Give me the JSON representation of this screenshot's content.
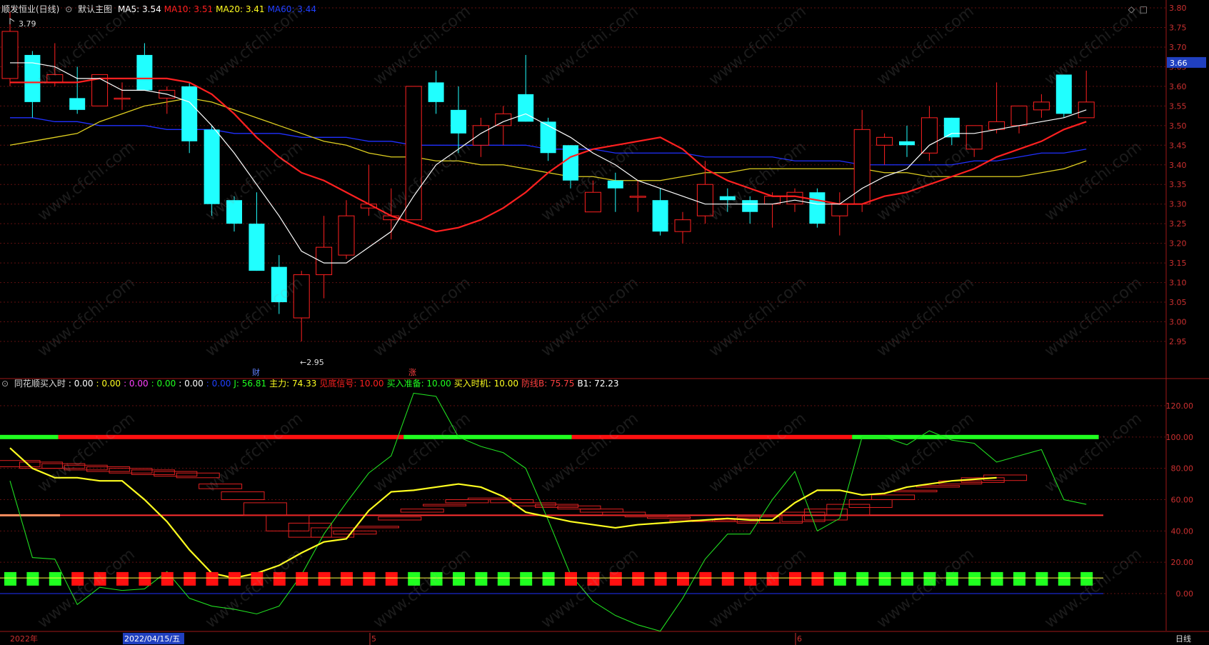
{
  "header": {
    "stock": "顺发恒业(日线)",
    "main_chart_label": "默认主图",
    "ma": [
      {
        "label": "MA5: 3.54",
        "color": "#ffffff"
      },
      {
        "label": "MA10: 3.51",
        "color": "#ff2020"
      },
      {
        "label": "MA20: 3.41",
        "color": "#ffff20"
      },
      {
        "label": "MA60: 3.44",
        "color": "#2040ff"
      }
    ]
  },
  "indicator_header": {
    "name": "同花顺买入时",
    "values": [
      {
        "label": ": 0.00",
        "color": "#ffffff"
      },
      {
        "label": ": 0.00",
        "color": "#ffff20"
      },
      {
        "label": ": 0.00",
        "color": "#ff40ff"
      },
      {
        "label": ": 0.00",
        "color": "#20ff20"
      },
      {
        "label": ": 0.00",
        "color": "#ffffff"
      },
      {
        "label": ": 0.00",
        "color": "#2040ff"
      },
      {
        "label": "J: 56.81",
        "color": "#20ff20"
      },
      {
        "label": "主力: 74.33",
        "color": "#ffff20"
      },
      {
        "label": "见底信号: 10.00",
        "color": "#ff2020"
      },
      {
        "label": "买入准备: 10.00",
        "color": "#20ff20"
      },
      {
        "label": "买入时机: 10.00",
        "color": "#ffff20"
      },
      {
        "label": "防线B: 75.75",
        "color": "#ff4040"
      },
      {
        "label": "B1: 72.23",
        "color": "#ffffff"
      }
    ]
  },
  "annotations": {
    "high_label": "3.79",
    "low_label": "←2.95",
    "event_cai": "财",
    "event_zhang": "涨"
  },
  "price_tag": "3.66",
  "bottom": {
    "date_left": "2022年",
    "date_cursor": "2022/04/15/五",
    "month_5": "5",
    "month_6": "6",
    "period": "日线"
  },
  "watermark": "www.cfchi.com",
  "colors": {
    "up": "#ff2020",
    "down": "#20ffff",
    "ma5": "#ffffff",
    "ma10": "#ff2020",
    "ma20": "#e0d020",
    "ma60": "#2030ff"
  },
  "chart_data": [
    {
      "type": "candlestick",
      "title": "顺发恒业(日线)",
      "y_ticks": [
        "3.80",
        "3.75",
        "3.70",
        "3.65",
        "3.60",
        "3.55",
        "3.50",
        "3.45",
        "3.40",
        "3.35",
        "3.30",
        "3.25",
        "3.20",
        "3.15",
        "3.10",
        "3.05",
        "3.00",
        "2.95"
      ],
      "ylim": [
        2.91,
        3.82
      ],
      "ohlc": [
        [
          3.62,
          3.79,
          3.6,
          3.74
        ],
        [
          3.68,
          3.69,
          3.52,
          3.56
        ],
        [
          3.61,
          3.71,
          3.6,
          3.63
        ],
        [
          3.57,
          3.65,
          3.53,
          3.54
        ],
        [
          3.55,
          3.63,
          3.55,
          3.63
        ],
        [
          3.57,
          3.61,
          3.54,
          3.57
        ],
        [
          3.68,
          3.71,
          3.59,
          3.59
        ],
        [
          3.57,
          3.6,
          3.53,
          3.59
        ],
        [
          3.6,
          3.61,
          3.43,
          3.46
        ],
        [
          3.49,
          3.5,
          3.27,
          3.3
        ],
        [
          3.31,
          3.32,
          3.23,
          3.25
        ],
        [
          3.25,
          3.33,
          3.13,
          3.13
        ],
        [
          3.14,
          3.17,
          3.02,
          3.05
        ],
        [
          3.01,
          3.13,
          2.95,
          3.12
        ],
        [
          3.12,
          3.27,
          3.06,
          3.19
        ],
        [
          3.17,
          3.31,
          3.16,
          3.27
        ],
        [
          3.29,
          3.4,
          3.27,
          3.3
        ],
        [
          3.26,
          3.34,
          3.21,
          3.27
        ],
        [
          3.26,
          3.6,
          3.26,
          3.6
        ],
        [
          3.61,
          3.64,
          3.53,
          3.56
        ],
        [
          3.54,
          3.6,
          3.43,
          3.48
        ],
        [
          3.45,
          3.52,
          3.42,
          3.5
        ],
        [
          3.5,
          3.55,
          3.45,
          3.53
        ],
        [
          3.58,
          3.68,
          3.51,
          3.51
        ],
        [
          3.51,
          3.52,
          3.41,
          3.43
        ],
        [
          3.45,
          3.45,
          3.34,
          3.36
        ],
        [
          3.28,
          3.36,
          3.28,
          3.33
        ],
        [
          3.36,
          3.38,
          3.28,
          3.34
        ],
        [
          3.32,
          3.36,
          3.28,
          3.32
        ],
        [
          3.31,
          3.34,
          3.22,
          3.23
        ],
        [
          3.23,
          3.28,
          3.2,
          3.26
        ],
        [
          3.27,
          3.41,
          3.25,
          3.35
        ],
        [
          3.32,
          3.34,
          3.28,
          3.31
        ],
        [
          3.31,
          3.32,
          3.25,
          3.28
        ],
        [
          3.3,
          3.33,
          3.24,
          3.32
        ],
        [
          3.3,
          3.34,
          3.28,
          3.33
        ],
        [
          3.33,
          3.34,
          3.24,
          3.25
        ],
        [
          3.27,
          3.33,
          3.22,
          3.3
        ],
        [
          3.3,
          3.54,
          3.28,
          3.49
        ],
        [
          3.45,
          3.48,
          3.4,
          3.47
        ],
        [
          3.46,
          3.5,
          3.42,
          3.45
        ],
        [
          3.43,
          3.55,
          3.41,
          3.52
        ],
        [
          3.52,
          3.52,
          3.45,
          3.47
        ],
        [
          3.44,
          3.5,
          3.42,
          3.5
        ],
        [
          3.49,
          3.61,
          3.48,
          3.51
        ],
        [
          3.5,
          3.55,
          3.48,
          3.55
        ],
        [
          3.54,
          3.58,
          3.52,
          3.56
        ],
        [
          3.63,
          3.63,
          3.52,
          3.53
        ],
        [
          3.52,
          3.64,
          3.52,
          3.56
        ]
      ],
      "ma5": [
        3.66,
        3.66,
        3.65,
        3.62,
        3.62,
        3.59,
        3.59,
        3.58,
        3.56,
        3.5,
        3.43,
        3.35,
        3.27,
        3.18,
        3.15,
        3.15,
        3.19,
        3.23,
        3.32,
        3.4,
        3.44,
        3.48,
        3.51,
        3.53,
        3.5,
        3.47,
        3.43,
        3.4,
        3.36,
        3.34,
        3.32,
        3.3,
        3.3,
        3.3,
        3.3,
        3.31,
        3.3,
        3.3,
        3.34,
        3.37,
        3.39,
        3.45,
        3.48,
        3.48,
        3.49,
        3.5,
        3.51,
        3.52,
        3.54
      ],
      "ma10": [
        3.61,
        3.61,
        3.61,
        3.61,
        3.62,
        3.62,
        3.62,
        3.62,
        3.61,
        3.58,
        3.53,
        3.47,
        3.42,
        3.38,
        3.36,
        3.33,
        3.3,
        3.27,
        3.25,
        3.23,
        3.24,
        3.26,
        3.29,
        3.33,
        3.38,
        3.42,
        3.44,
        3.45,
        3.46,
        3.47,
        3.44,
        3.39,
        3.36,
        3.34,
        3.32,
        3.32,
        3.31,
        3.3,
        3.3,
        3.32,
        3.33,
        3.35,
        3.37,
        3.39,
        3.42,
        3.44,
        3.46,
        3.49,
        3.51
      ],
      "ma20": [
        3.45,
        3.46,
        3.47,
        3.48,
        3.51,
        3.53,
        3.55,
        3.56,
        3.57,
        3.56,
        3.54,
        3.52,
        3.5,
        3.48,
        3.46,
        3.45,
        3.43,
        3.42,
        3.42,
        3.41,
        3.41,
        3.4,
        3.4,
        3.39,
        3.38,
        3.37,
        3.37,
        3.36,
        3.36,
        3.36,
        3.37,
        3.38,
        3.38,
        3.39,
        3.39,
        3.39,
        3.39,
        3.39,
        3.39,
        3.38,
        3.38,
        3.37,
        3.37,
        3.37,
        3.37,
        3.37,
        3.38,
        3.39,
        3.41
      ],
      "ma60": [
        3.52,
        3.52,
        3.51,
        3.51,
        3.5,
        3.5,
        3.5,
        3.49,
        3.49,
        3.49,
        3.48,
        3.48,
        3.48,
        3.47,
        3.47,
        3.47,
        3.46,
        3.46,
        3.45,
        3.45,
        3.45,
        3.45,
        3.45,
        3.45,
        3.44,
        3.44,
        3.44,
        3.43,
        3.43,
        3.43,
        3.43,
        3.42,
        3.42,
        3.42,
        3.42,
        3.41,
        3.41,
        3.41,
        3.4,
        3.4,
        3.4,
        3.4,
        3.4,
        3.41,
        3.41,
        3.42,
        3.43,
        3.43,
        3.44
      ]
    },
    {
      "type": "line",
      "title": "同花顺买入时",
      "y_ticks": [
        "120.00",
        "100.00",
        "80.00",
        "60.00",
        "40.00",
        "20.00",
        "0.00"
      ],
      "ylim": [
        -8,
        132
      ],
      "series": [
        {
          "name": "J",
          "values": [
            72,
            23,
            22,
            -7,
            4,
            2,
            3,
            14,
            -3,
            -8,
            -10,
            -13,
            -8,
            12,
            38,
            58,
            77,
            88,
            128,
            126,
            100,
            94,
            90,
            80,
            47,
            12,
            -5,
            -14,
            -20,
            -24,
            -3,
            22,
            38,
            38,
            60,
            78,
            40,
            48,
            100,
            100,
            95,
            104,
            98,
            96,
            84,
            88,
            92,
            60,
            57
          ]
        },
        {
          "name": "主力",
          "values": [
            93,
            80,
            74,
            74,
            72,
            72,
            60,
            46,
            28,
            13,
            10,
            13,
            18,
            26,
            33,
            35,
            53,
            65,
            66,
            68,
            70,
            68,
            62,
            52,
            49,
            46,
            44,
            42,
            44,
            45,
            46,
            47,
            48,
            47,
            47,
            58,
            66,
            66,
            63,
            64,
            68,
            70,
            72,
            73,
            74
          ]
        },
        {
          "name": "防线B",
          "values": [
            85,
            84,
            83,
            82,
            81,
            80,
            79,
            78,
            77,
            70,
            65,
            58,
            50,
            45,
            42,
            40,
            43,
            47,
            52,
            56,
            58,
            60,
            58,
            56,
            55,
            54,
            52,
            50,
            49,
            48,
            47,
            47,
            48,
            49,
            50,
            52,
            54,
            57,
            60,
            63,
            66,
            69,
            72,
            74,
            75.75
          ]
        },
        {
          "name": "B1",
          "values": [
            81,
            80,
            80,
            79,
            78,
            77,
            76,
            75,
            74,
            67,
            60,
            50,
            40,
            36,
            36,
            38,
            42,
            49,
            54,
            57,
            60,
            61,
            60,
            58,
            57,
            56,
            54,
            52,
            50,
            49,
            47,
            46,
            46,
            45,
            45,
            46,
            47,
            50,
            55,
            60,
            65,
            68,
            70,
            71,
            72.23
          ]
        }
      ],
      "signal_squares": [
        "g",
        "g",
        "g",
        "r",
        "r",
        "r",
        "r",
        "r",
        "r",
        "r",
        "r",
        "r",
        "r",
        "r",
        "r",
        "r",
        "r",
        "r",
        "g",
        "g",
        "g",
        "g",
        "g",
        "g",
        "g",
        "r",
        "r",
        "r",
        "r",
        "r",
        "r",
        "r",
        "r",
        "r",
        "r",
        "r",
        "r",
        "g",
        "g",
        "g",
        "g",
        "g",
        "g",
        "g",
        "g",
        "g",
        "g",
        "g",
        "g"
      ],
      "state_bar_100": [
        [
          "g",
          0,
          2.6
        ],
        [
          "r",
          2.6,
          18
        ],
        [
          "g",
          18,
          25.5
        ],
        [
          "r",
          25.5,
          38
        ],
        [
          "g",
          38,
          49
        ]
      ],
      "line_50": 49
    }
  ]
}
